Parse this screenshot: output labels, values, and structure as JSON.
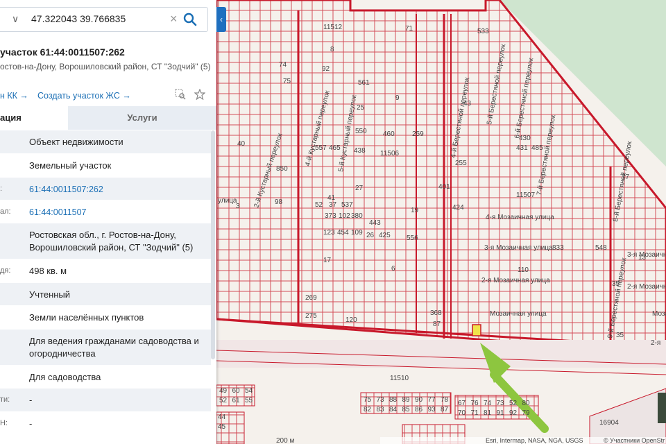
{
  "search": {
    "value": "47.322043 39.766835"
  },
  "object": {
    "title": "участок 61:44:0011507:262",
    "address": "остов-на-Дону, Ворошиловский район, СТ \"Зодчий\" (5)"
  },
  "links": {
    "kk": "н КК →",
    "create": "Создать участок ЖС →"
  },
  "tabs": {
    "info": "ация",
    "services": "Услуги"
  },
  "rows": [
    {
      "label": "",
      "value": "Объект недвижимости"
    },
    {
      "label": "",
      "value": "Земельный участок"
    },
    {
      "label": ":",
      "value": "61:44:0011507:262"
    },
    {
      "label": "ал:",
      "value": "61:44:0011507"
    },
    {
      "label": "",
      "value": "Ростовская обл., г. Ростов-на-Дону, Ворошиловский район, СТ \"Зодчий\" (5)"
    },
    {
      "label": "дя:",
      "value": "498 кв. м"
    },
    {
      "label": "",
      "value": "Учтенный"
    },
    {
      "label": "",
      "value": "Земли населённых пунктов"
    },
    {
      "label": "",
      "value": "Для ведения гражданами садоводства и огородничества"
    },
    {
      "label": "",
      "value": "Для садоводства"
    },
    {
      "label": "ти:",
      "value": "-"
    },
    {
      "label": "Н:",
      "value": "-"
    }
  ],
  "map": {
    "streets": [
      "2-й Кустарный переулок",
      "4-й Кустарный переулок",
      "5-й Кустарный переулок",
      "4-й Берестяной переулок",
      "5-й Берестяной переулок",
      "6-й Берестяной переулок",
      "7-й Берестяной переулок",
      "8-й Берестяной переулок",
      "9-й Берестяной переулок",
      "4-я Мозаичная улица",
      "3-я Мозаичная улица",
      "2-я Мозаичная улица",
      "Мозаичная улица",
      "3-я Мозаичная",
      "2-я Мозаичная",
      "Моза",
      "2-я",
      "улица"
    ],
    "blocks": [
      "11507",
      "11506",
      "11510",
      "11512",
      "16904"
    ],
    "plot_numbers": [
      "533",
      "561",
      "25",
      "550",
      "460",
      "259",
      "557",
      "465",
      "438",
      "255",
      "27",
      "401",
      "424",
      "41",
      "52",
      "37",
      "537",
      "19",
      "373",
      "102",
      "380",
      "443",
      "123",
      "454",
      "109",
      "26",
      "425",
      "556",
      "17",
      "6",
      "833",
      "275",
      "269",
      "120",
      "368",
      "87",
      "850",
      "98",
      "74",
      "75",
      "43",
      "430",
      "431",
      "485",
      "77",
      "548",
      "110",
      "13",
      "35",
      "3",
      "40",
      "92",
      "8",
      "71",
      "9",
      "35"
    ],
    "bottom_rows": [
      [
        "75",
        "73",
        "88",
        "89",
        "90",
        "77",
        "78"
      ],
      [
        "82",
        "83",
        "84",
        "85",
        "86",
        "93",
        "87"
      ],
      [
        "67",
        "76",
        "74",
        "73",
        "52",
        "80"
      ],
      [
        "70",
        "71",
        "81",
        "91",
        "92",
        "79"
      ],
      [
        "49",
        "60",
        "54"
      ],
      [
        "52",
        "61",
        "55"
      ],
      [
        "44"
      ],
      [
        "45"
      ]
    ],
    "scale": "200 м",
    "attribution": "© Участники OpenStr",
    "credits": "Esri, Intermap, NASA, NGA, USGS"
  },
  "colors": {
    "accent": "#1b6fb5",
    "parcel": "#c8192b",
    "highlight": "#f1e34b",
    "arrow": "#8dc63f"
  }
}
